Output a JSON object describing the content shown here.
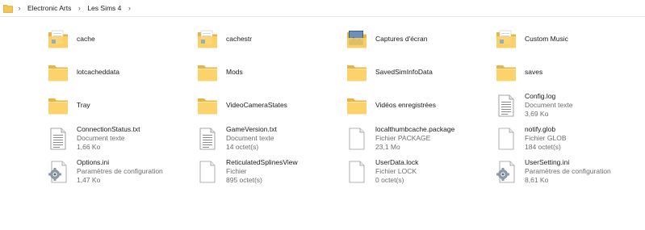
{
  "breadcrumb": {
    "parts": [
      "Electronic Arts",
      "Les Sims 4"
    ]
  },
  "items": [
    {
      "name": "cache",
      "icon": "folder-documents-icon"
    },
    {
      "name": "cachestr",
      "icon": "folder-documents-icon"
    },
    {
      "name": "Captures d'écran",
      "icon": "folder-pictures-icon"
    },
    {
      "name": "Custom Music",
      "icon": "folder-documents-icon"
    },
    {
      "name": "lotcacheddata",
      "icon": "folder-icon"
    },
    {
      "name": "Mods",
      "icon": "folder-icon"
    },
    {
      "name": "SavedSimInfoData",
      "icon": "folder-icon"
    },
    {
      "name": "saves",
      "icon": "folder-icon"
    },
    {
      "name": "Tray",
      "icon": "folder-icon"
    },
    {
      "name": "VideoCameraStates",
      "icon": "folder-icon"
    },
    {
      "name": "Vidéos enregistrées",
      "icon": "folder-icon"
    },
    {
      "name": "Config.log",
      "type": "Document texte",
      "size": "3,69 Ko",
      "icon": "text-document-icon"
    },
    {
      "name": "ConnectionStatus.txt",
      "type": "Document texte",
      "size": "1,66 Ko",
      "icon": "text-document-icon"
    },
    {
      "name": "GameVersion.txt",
      "type": "Document texte",
      "size": "14 octet(s)",
      "icon": "text-document-icon"
    },
    {
      "name": "localthumbcache.package",
      "type": "Fichier PACKAGE",
      "size": "23,1 Mo",
      "icon": "blank-file-icon"
    },
    {
      "name": "notify.glob",
      "type": "Fichier GLOB",
      "size": "184 octet(s)",
      "icon": "blank-file-icon"
    },
    {
      "name": "Options.ini",
      "type": "Paramètres de configuration",
      "size": "1,47 Ko",
      "icon": "config-settings-icon"
    },
    {
      "name": "ReticulatedSplinesView",
      "type": "Fichier",
      "size": "895 octet(s)",
      "icon": "blank-file-icon"
    },
    {
      "name": "UserData.lock",
      "type": "Fichier LOCK",
      "size": "0 octet(s)",
      "icon": "blank-file-icon"
    },
    {
      "name": "UserSetting.ini",
      "type": "Paramètres de configuration",
      "size": "8,61 Ko",
      "icon": "config-settings-icon"
    }
  ]
}
